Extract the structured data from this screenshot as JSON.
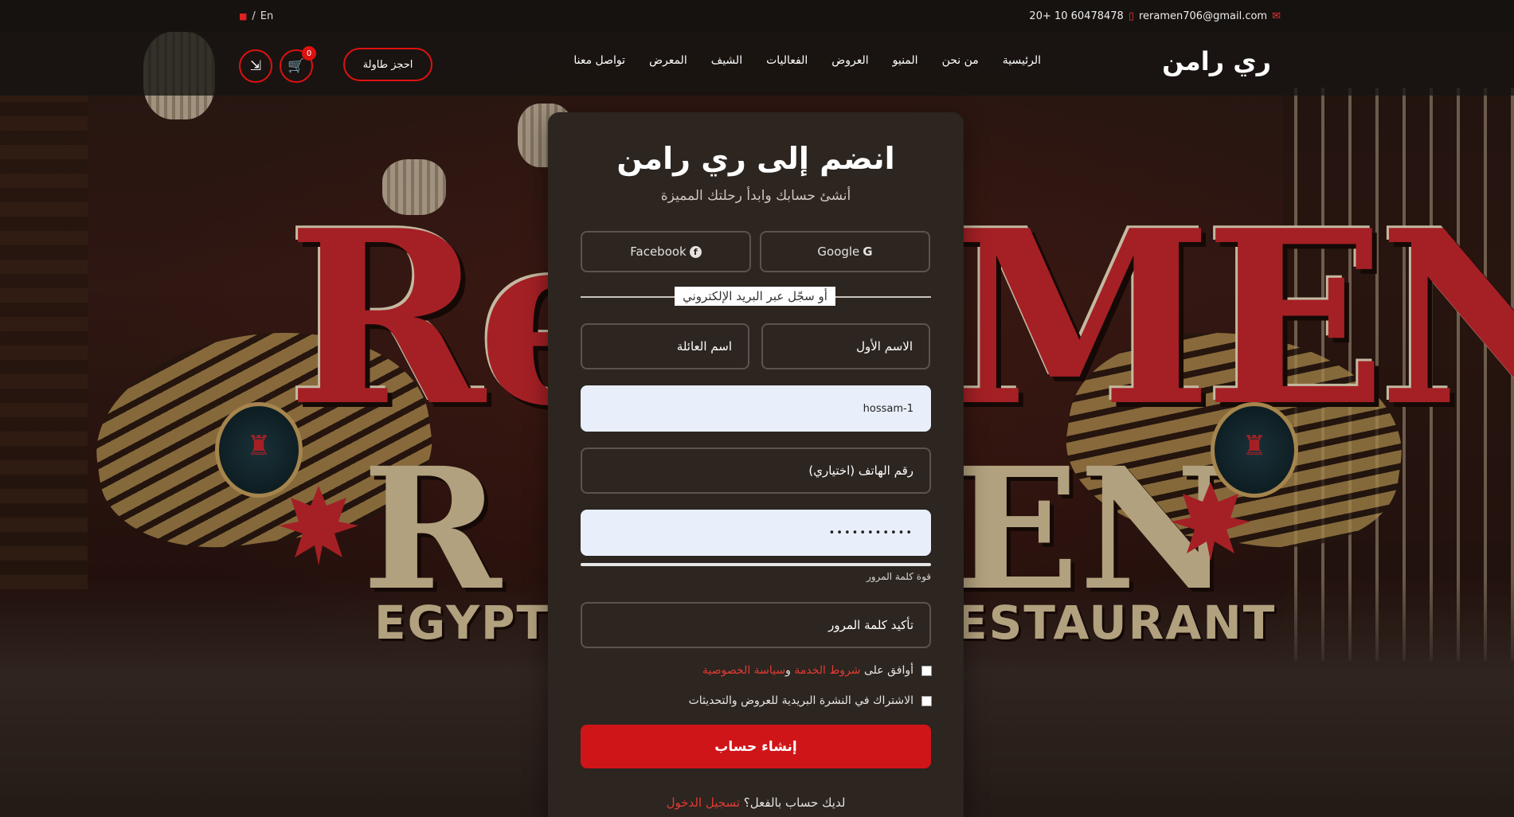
{
  "topbar": {
    "lang_label": "En",
    "lang_separator": "/",
    "email": "reramen706@gmail.com",
    "phone": "20+ 10 60478478"
  },
  "nav": {
    "brand": "ري رامن",
    "menu": [
      "الرئيسية",
      "من نحن",
      "المنيو",
      "العروض",
      "الفعاليات",
      "الشيف",
      "المعرض",
      "تواصل معنا"
    ],
    "reserve_label": "احجز طاولة",
    "cart_count": "0"
  },
  "background": {
    "logo_left": "Re",
    "logo_right": "MEN",
    "sub_left": "R",
    "sub_right": "EN",
    "word_left": "EGYPTIAN",
    "word_right": "ESTAURANT"
  },
  "form": {
    "title": "انضم إلى ري رامن",
    "subtitle": "أنشئ حسابك وابدأ رحلتك المميزة",
    "google_label": "Google",
    "facebook_label": "Facebook",
    "divider_label": "أو سجّل عبر البريد الإلكتروني",
    "first_name_placeholder": "الاسم الأول",
    "last_name_placeholder": "اسم العائلة",
    "email_value": "hossam-1",
    "phone_placeholder": "رقم الهاتف (اختياري)",
    "password_value": "•••••••••••",
    "strength_label": "قوة كلمة المرور",
    "confirm_placeholder": "تأكيد كلمة المرور",
    "terms_prefix": "أوافق على ",
    "terms_link": "شروط الخدمة",
    "terms_and": " و",
    "privacy_link": "سياسة الخصوصية",
    "newsletter_label": "الاشتراك في النشرة البريدية للعروض والتحديثات",
    "submit_label": "إنشاء حساب",
    "have_account": "لديك حساب بالفعل؟",
    "login_link": " تسجيل الدخول"
  },
  "colors": {
    "accent": "#d01518",
    "card": "#2c2520",
    "input_light": "#e8effb"
  }
}
